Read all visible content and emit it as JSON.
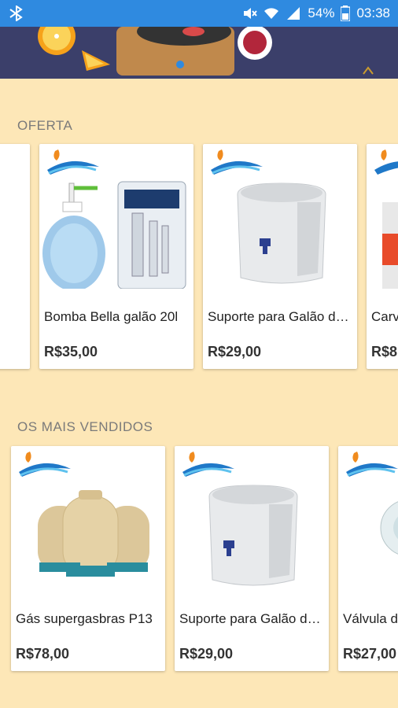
{
  "status_bar": {
    "battery": "54%",
    "time": "03:38",
    "icons": [
      "bluetooth-icon",
      "mute-icon",
      "wifi-icon",
      "signal-icon"
    ]
  },
  "banner": {
    "slide_indicator": "active"
  },
  "sections": {
    "offers": {
      "title": "OFERTA",
      "items": [
        {
          "name": "Bomba Bella galão 20l",
          "price": "R$35,00"
        },
        {
          "name": "Suporte para Galão de Água",
          "price": "R$29,00"
        },
        {
          "name": "Carv",
          "price": "R$8"
        }
      ]
    },
    "best_sellers": {
      "title": "OS MAIS VENDIDOS",
      "items": [
        {
          "name": "Gás supergasbras P13",
          "price": "R$78,00"
        },
        {
          "name": "Suporte para Galão de Água",
          "price": "R$29,00"
        },
        {
          "name": "Válvula d",
          "price": "R$27,00"
        }
      ]
    }
  },
  "colors": {
    "status_bar": "#2f8ae0",
    "background": "#fde7b7",
    "banner": "#3b3f6a"
  }
}
